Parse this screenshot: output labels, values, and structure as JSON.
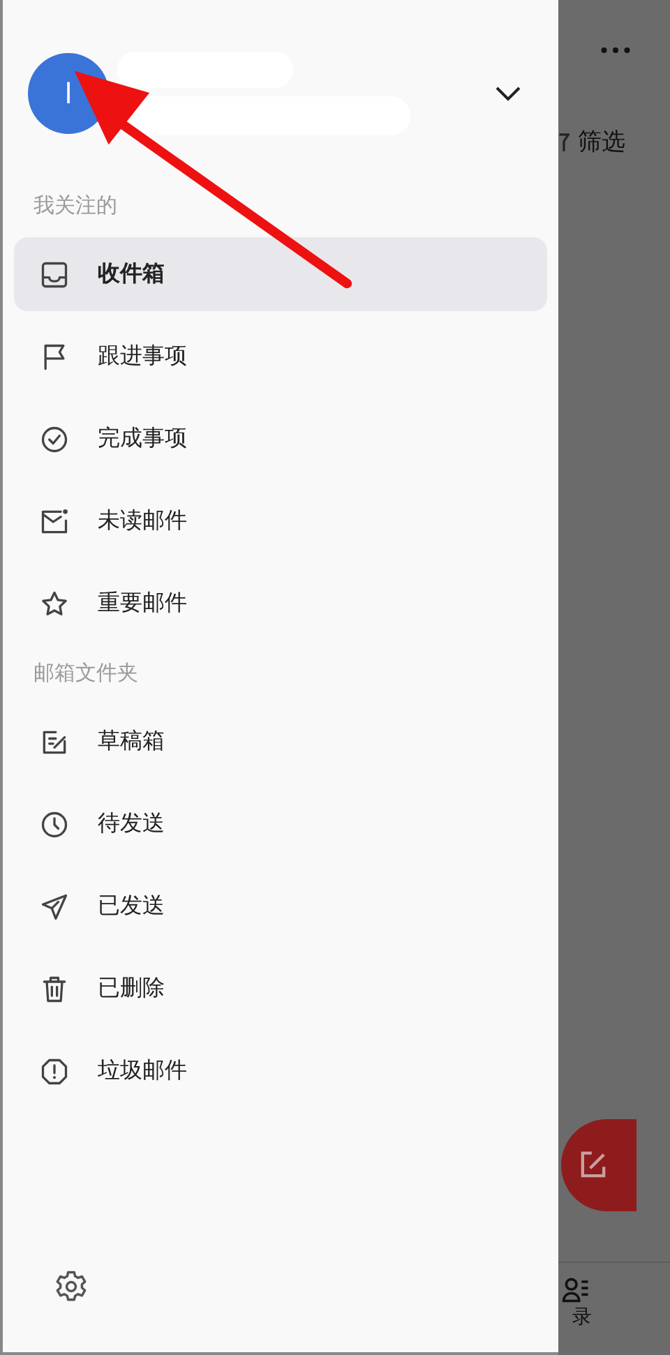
{
  "account": {
    "avatar_letter": "l",
    "expanded": false
  },
  "sections": [
    {
      "title": "我关注的",
      "items": [
        {
          "label": "收件箱",
          "selected": true
        },
        {
          "label": "跟进事项",
          "selected": false
        },
        {
          "label": "完成事项",
          "selected": false
        },
        {
          "label": "未读邮件",
          "selected": false
        },
        {
          "label": "重要邮件",
          "selected": false
        }
      ]
    },
    {
      "title": "邮箱文件夹",
      "items": [
        {
          "label": "草稿箱",
          "selected": false
        },
        {
          "label": "待发送",
          "selected": false
        },
        {
          "label": "已发送",
          "selected": false
        },
        {
          "label": "已删除",
          "selected": false
        },
        {
          "label": "垃圾邮件",
          "selected": false
        }
      ]
    }
  ],
  "background": {
    "filter_label": "筛选",
    "tab_label": "录"
  }
}
